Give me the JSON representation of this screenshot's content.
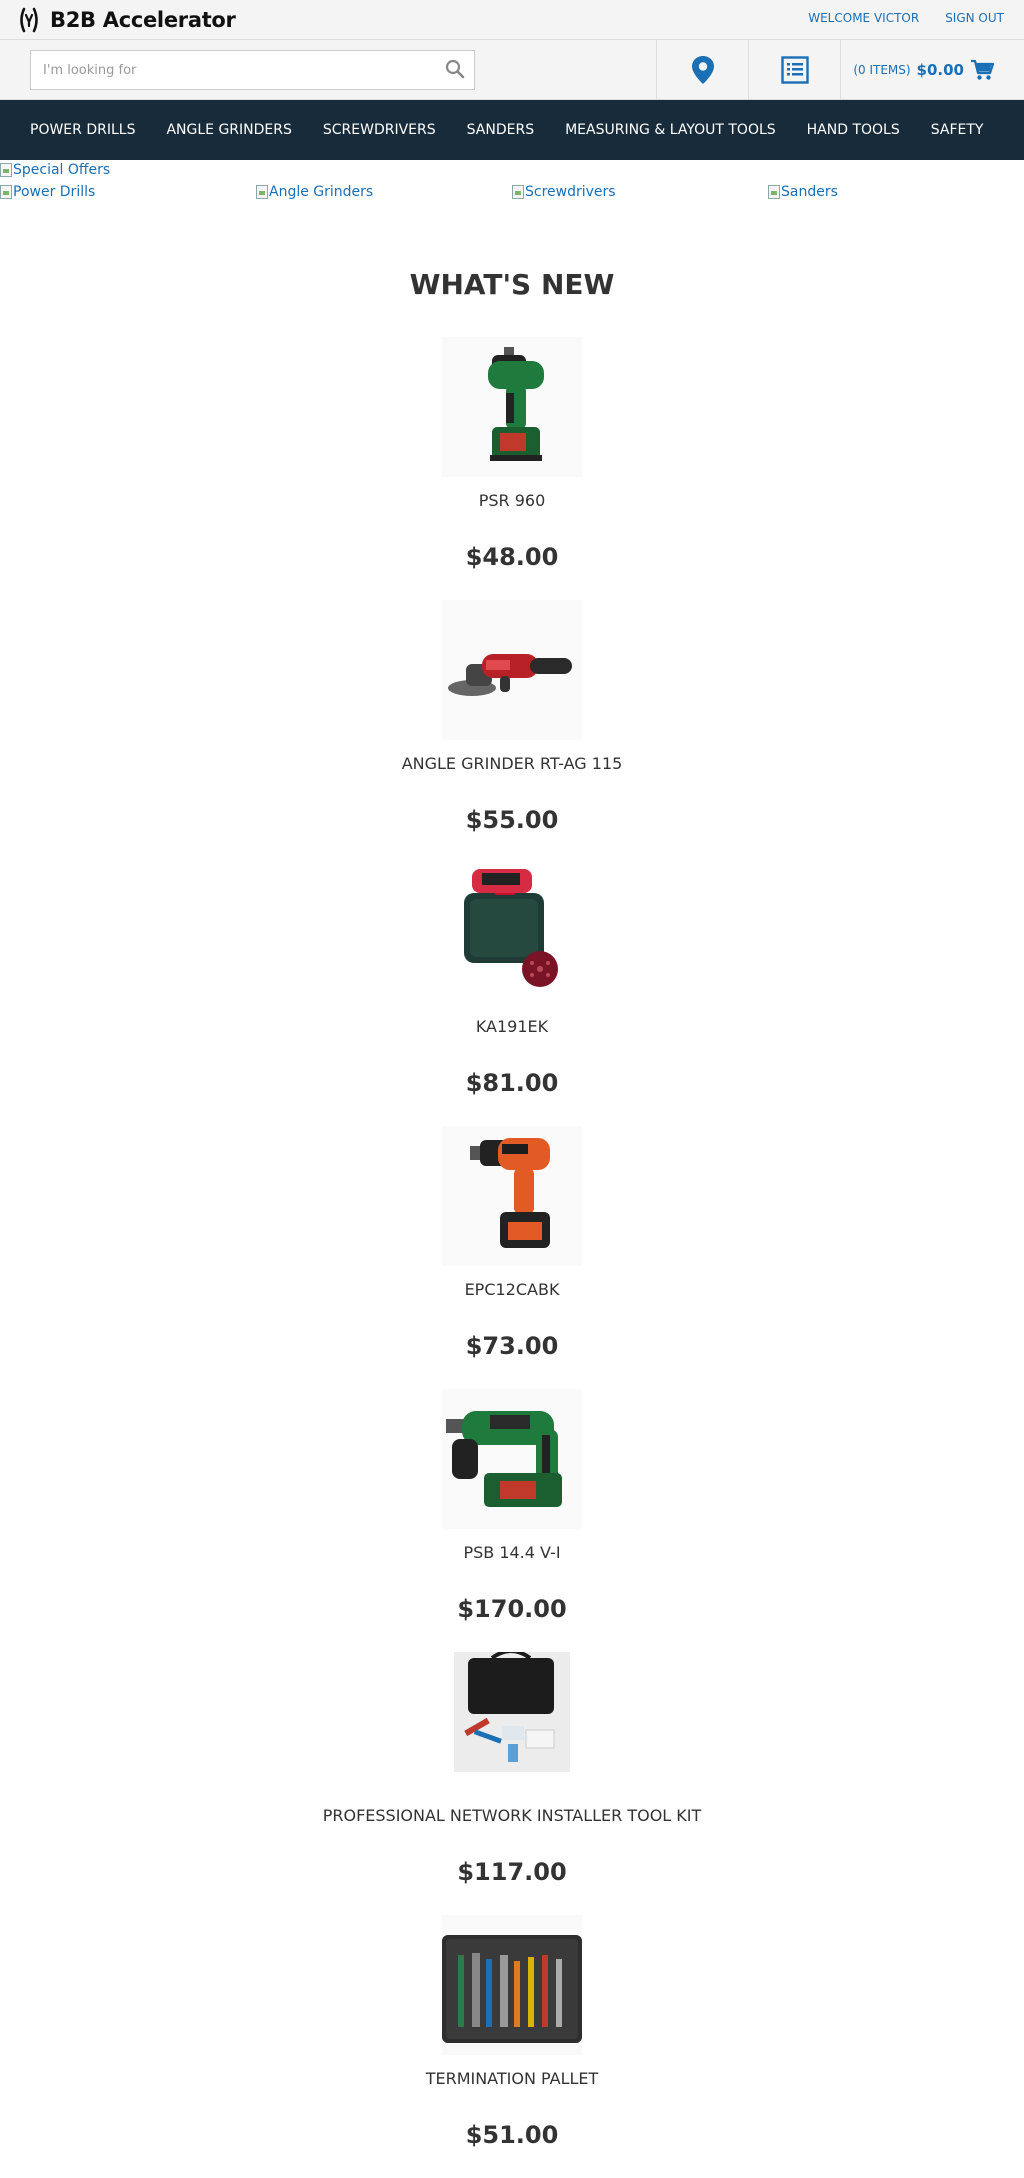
{
  "header": {
    "logo_text": "B2B Accelerator",
    "welcome": "WELCOME VICTOR",
    "sign_out": "SIGN OUT"
  },
  "search": {
    "placeholder": "I'm looking for",
    "value": ""
  },
  "cart": {
    "items": "(0 ITEMS)",
    "total": "$0.00"
  },
  "nav": {
    "items": [
      {
        "label": "POWER DRILLS"
      },
      {
        "label": "ANGLE GRINDERS"
      },
      {
        "label": "SCREWDRIVERS"
      },
      {
        "label": "SANDERS"
      },
      {
        "label": "MEASURING & LAYOUT TOOLS"
      },
      {
        "label": "HAND TOOLS"
      },
      {
        "label": "SAFETY"
      }
    ]
  },
  "banners": {
    "special_offers": "Special Offers",
    "categories": [
      {
        "label": "Power Drills"
      },
      {
        "label": "Angle Grinders"
      },
      {
        "label": "Screwdrivers"
      },
      {
        "label": "Sanders"
      }
    ]
  },
  "whats_new": {
    "title": "WHAT'S NEW",
    "products": [
      {
        "name": "PSR 960",
        "price": "$48.00",
        "image": "green-cordless-drill"
      },
      {
        "name": "ANGLE GRINDER RT-AG 115",
        "price": "$55.00",
        "image": "red-angle-grinder"
      },
      {
        "name": "KA191EK",
        "price": "$81.00",
        "image": "sander-case-kit"
      },
      {
        "name": "EPC12CABK",
        "price": "$73.00",
        "image": "orange-cordless-drill"
      },
      {
        "name": "PSB 14.4 V-I",
        "price": "$170.00",
        "image": "green-hammer-drill"
      },
      {
        "name": "PROFESSIONAL NETWORK INSTALLER TOOL KIT",
        "price": "$117.00",
        "image": "network-tool-kit-bag"
      },
      {
        "name": "TERMINATION PALLET",
        "price": "$51.00",
        "image": "tool-roll-pallet"
      }
    ]
  },
  "colors": {
    "link_blue": "#1a6fb5",
    "nav_bg": "#172b3a",
    "header_bg": "#f4f4f4"
  }
}
